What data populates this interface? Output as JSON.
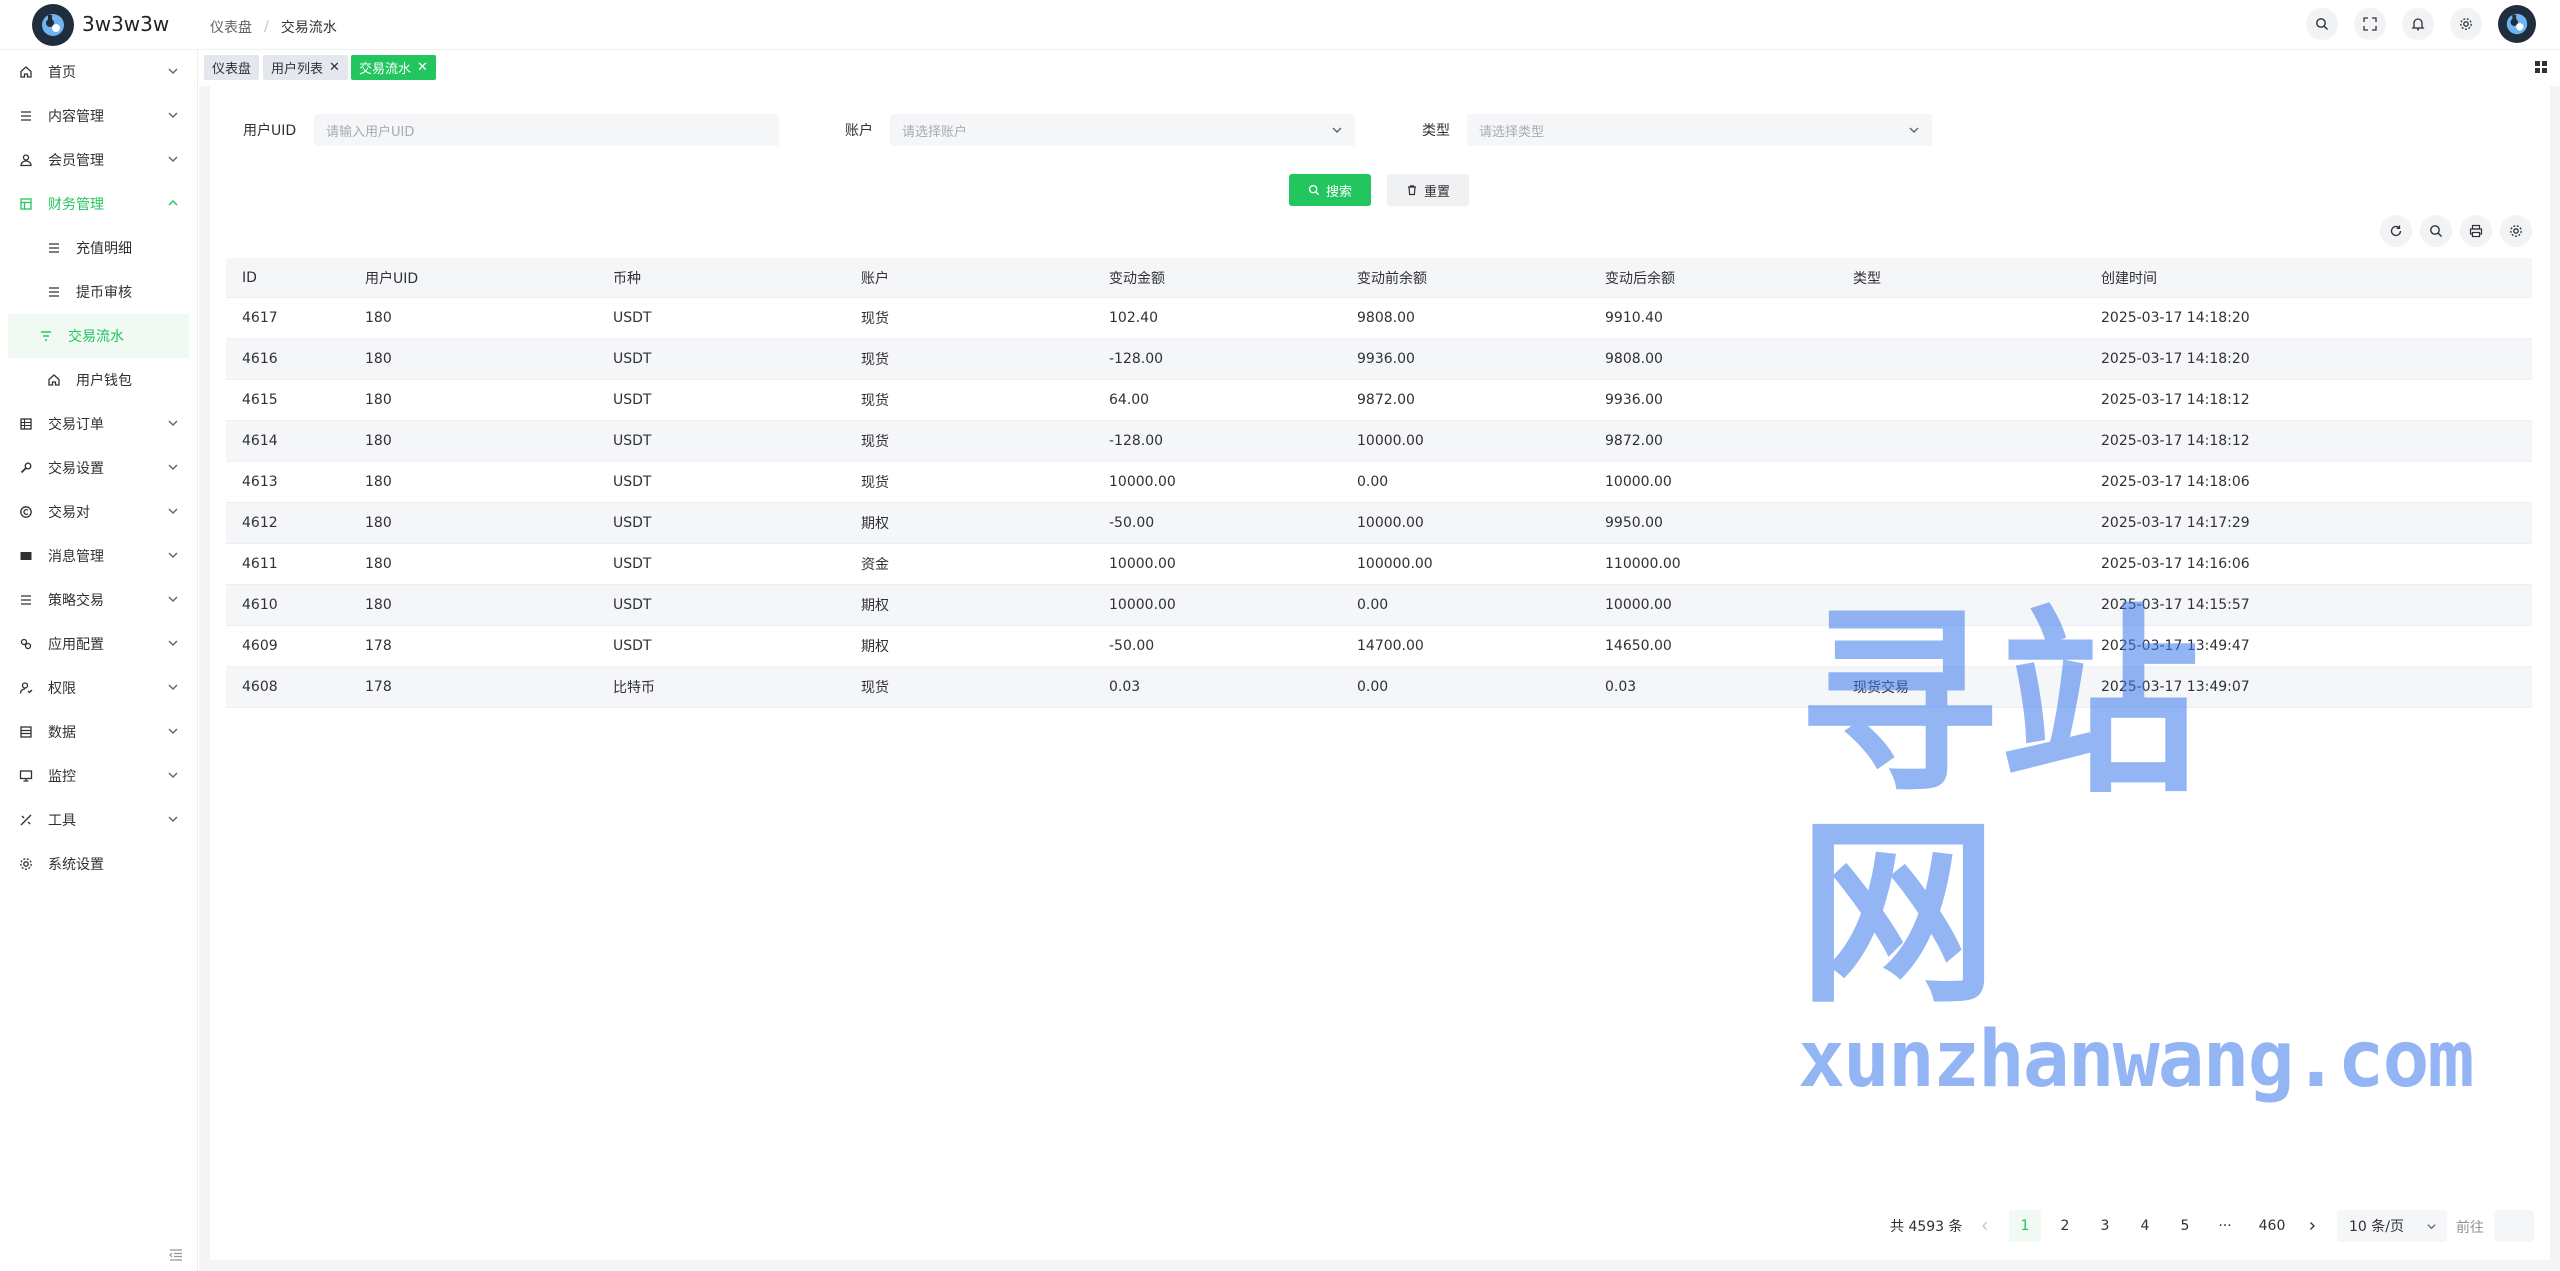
{
  "header": {
    "app_title": "3w3w3w",
    "breadcrumb": [
      "仪表盘",
      "交易流水"
    ]
  },
  "sidebar": {
    "items": [
      {
        "label": "首页",
        "icon": "home-icon",
        "expandable": true
      },
      {
        "label": "内容管理",
        "icon": "list-icon",
        "expandable": true
      },
      {
        "label": "会员管理",
        "icon": "user-icon",
        "expandable": true
      },
      {
        "label": "财务管理",
        "icon": "ledger-icon",
        "expandable": true,
        "expanded": true
      },
      {
        "label": "交易订单",
        "icon": "table-icon",
        "expandable": true
      },
      {
        "label": "交易设置",
        "icon": "wrench-icon",
        "expandable": true
      },
      {
        "label": "交易对",
        "icon": "copyright-icon",
        "expandable": true
      },
      {
        "label": "消息管理",
        "icon": "message-icon",
        "expandable": true
      },
      {
        "label": "策略交易",
        "icon": "list-icon",
        "expandable": true
      },
      {
        "label": "应用配置",
        "icon": "config-icon",
        "expandable": true
      },
      {
        "label": "权限",
        "icon": "permission-icon",
        "expandable": true
      },
      {
        "label": "数据",
        "icon": "data-icon",
        "expandable": true
      },
      {
        "label": "监控",
        "icon": "monitor-icon",
        "expandable": true
      },
      {
        "label": "工具",
        "icon": "tool-icon",
        "expandable": true
      },
      {
        "label": "系统设置",
        "icon": "gear-icon",
        "expandable": false
      }
    ],
    "finance_sub": [
      {
        "label": "充值明细",
        "icon": "list-icon"
      },
      {
        "label": "提币审核",
        "icon": "list-icon"
      },
      {
        "label": "交易流水",
        "icon": "filter-icon",
        "active": true
      },
      {
        "label": "用户钱包",
        "icon": "home-icon"
      }
    ]
  },
  "tags": [
    {
      "label": "仪表盘",
      "closable": false
    },
    {
      "label": "用户列表",
      "closable": true
    },
    {
      "label": "交易流水",
      "closable": true,
      "active": true
    }
  ],
  "filters": {
    "uid_label": "用户UID",
    "uid_placeholder": "请输入用户UID",
    "account_label": "账户",
    "account_placeholder": "请选择账户",
    "type_label": "类型",
    "type_placeholder": "请选择类型",
    "search_label": "搜索",
    "reset_label": "重置"
  },
  "table": {
    "columns": [
      "ID",
      "用户UID",
      "币种",
      "账户",
      "变动金额",
      "变动前余额",
      "变动后余额",
      "类型",
      "创建时间"
    ],
    "rows": [
      [
        "4617",
        "180",
        "USDT",
        "现货",
        "102.40",
        "9808.00",
        "9910.40",
        "",
        "2025-03-17 14:18:20"
      ],
      [
        "4616",
        "180",
        "USDT",
        "现货",
        "-128.00",
        "9936.00",
        "9808.00",
        "",
        "2025-03-17 14:18:20"
      ],
      [
        "4615",
        "180",
        "USDT",
        "现货",
        "64.00",
        "9872.00",
        "9936.00",
        "",
        "2025-03-17 14:18:12"
      ],
      [
        "4614",
        "180",
        "USDT",
        "现货",
        "-128.00",
        "10000.00",
        "9872.00",
        "",
        "2025-03-17 14:18:12"
      ],
      [
        "4613",
        "180",
        "USDT",
        "现货",
        "10000.00",
        "0.00",
        "10000.00",
        "",
        "2025-03-17 14:18:06"
      ],
      [
        "4612",
        "180",
        "USDT",
        "期权",
        "-50.00",
        "10000.00",
        "9950.00",
        "",
        "2025-03-17 14:17:29"
      ],
      [
        "4611",
        "180",
        "USDT",
        "资金",
        "10000.00",
        "100000.00",
        "110000.00",
        "",
        "2025-03-17 14:16:06"
      ],
      [
        "4610",
        "180",
        "USDT",
        "期权",
        "10000.00",
        "0.00",
        "10000.00",
        "",
        "2025-03-17 14:15:57"
      ],
      [
        "4609",
        "178",
        "USDT",
        "期权",
        "-50.00",
        "14700.00",
        "14650.00",
        "",
        "2025-03-17 13:49:47"
      ],
      [
        "4608",
        "178",
        "比特币",
        "现货",
        "0.03",
        "0.00",
        "0.03",
        "现货交易",
        "2025-03-17 13:49:07"
      ]
    ]
  },
  "pagination": {
    "total": "共 4593 条",
    "pages": [
      "1",
      "2",
      "3",
      "4",
      "5",
      "···",
      "460"
    ],
    "current_page": "1",
    "page_size": "10 条/页",
    "goto": "前往"
  },
  "watermark": {
    "cn": "寻站网",
    "en": "xunzhanwang.com"
  },
  "colors": {
    "accent": "#22c55e",
    "watermark": "#3c78eb"
  }
}
